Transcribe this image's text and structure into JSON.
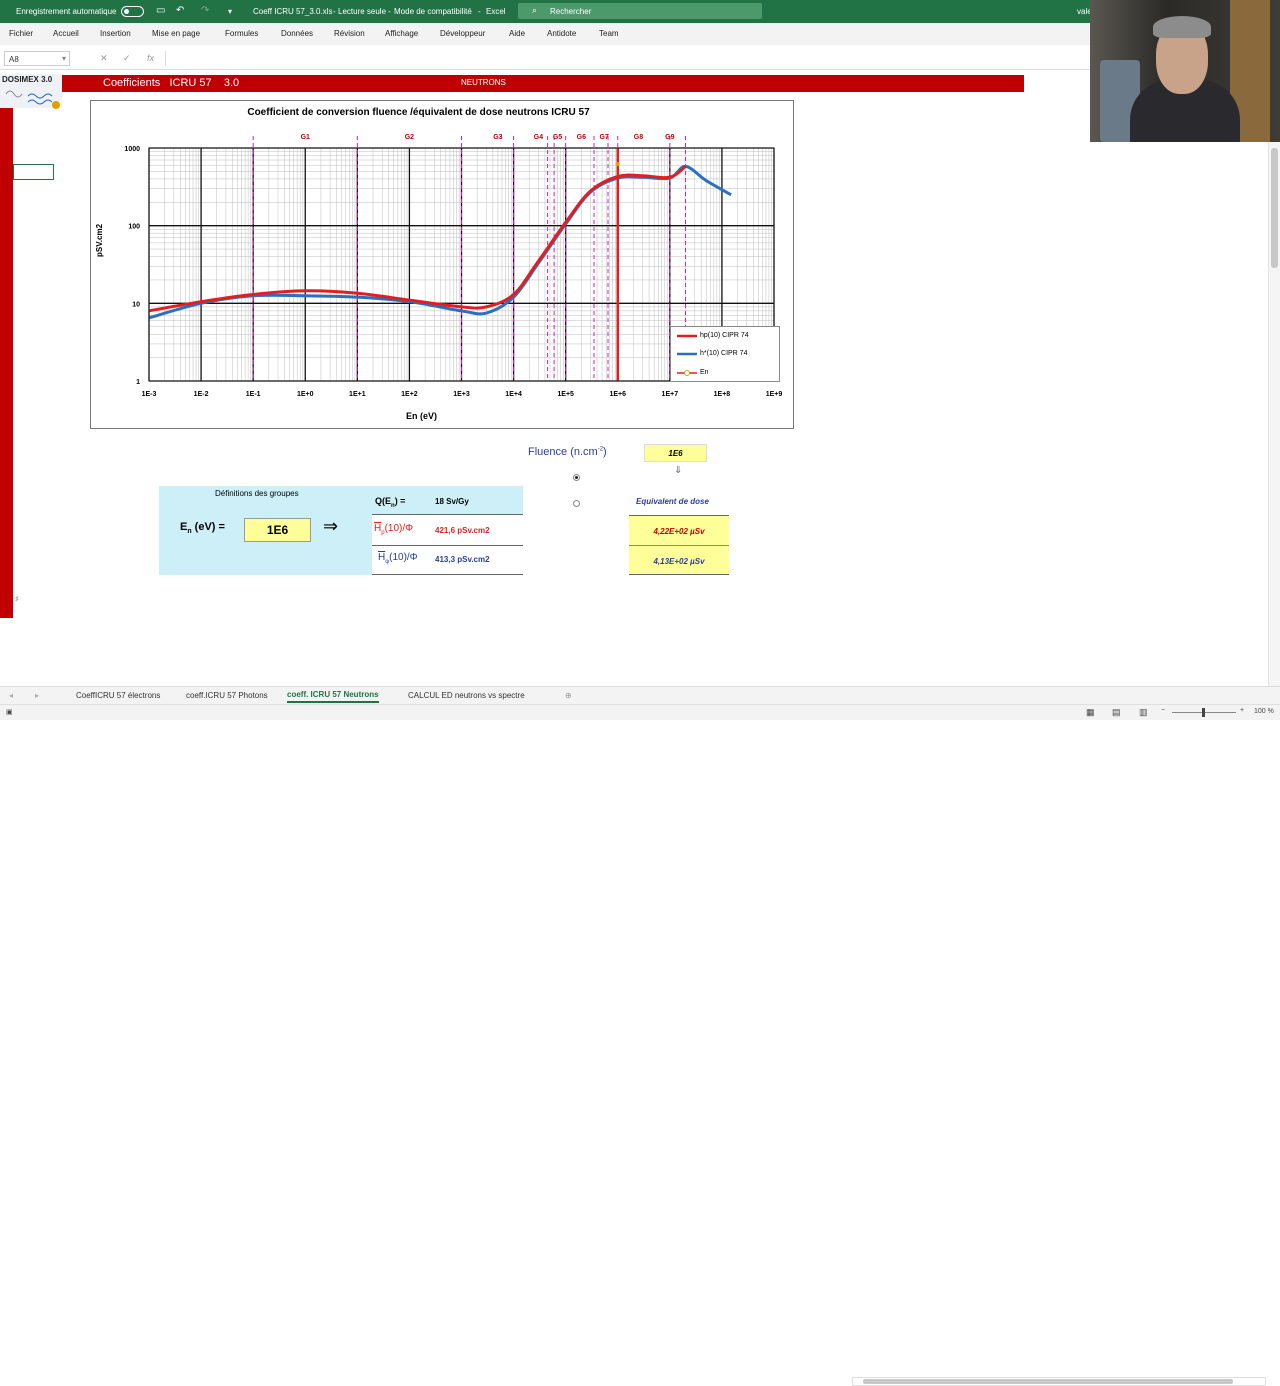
{
  "titlebar": {
    "autosave": "Enregistrement automatique",
    "filename": "Coeff ICRU 57_3.0.xls",
    "readonly": "Lecture seule",
    "compat": "Mode de compatibilité",
    "app": "Excel",
    "search_placeholder": "Rechercher",
    "user": "vale"
  },
  "menu": [
    "Fichier",
    "Accueil",
    "Insertion",
    "Mise en page",
    "Formules",
    "Données",
    "Révision",
    "Affichage",
    "Développeur",
    "Aide",
    "Antidote",
    "Team"
  ],
  "formula": {
    "cell_ref": "A8",
    "fx": "fx"
  },
  "banner": {
    "logo": "DOSIMEX 3.0",
    "title": "Coefficients   ICRU 57    3.0",
    "section": "NEUTRONS"
  },
  "chart_data": {
    "type": "line",
    "title": "Coefficient de conversion fluence /équivalent de dose neutrons ICRU 57",
    "xlabel": "En (eV)",
    "ylabel": "pSV.cm2",
    "xscale": "log",
    "yscale": "log",
    "xlim": [
      0.001,
      1000000000
    ],
    "ylim": [
      1,
      1000
    ],
    "xticks": [
      "1E-3",
      "1E-2",
      "1E-1",
      "1E+0",
      "1E+1",
      "1E+2",
      "1E+3",
      "1E+4",
      "1E+5",
      "1E+6",
      "1E+7",
      "1E+8",
      "1E+9"
    ],
    "yticks": [
      "1",
      "10",
      "100",
      "1000"
    ],
    "groups": [
      {
        "label": "G1",
        "x": 1
      },
      {
        "label": "G2",
        "x": 100
      },
      {
        "label": "G3",
        "x": 5000
      },
      {
        "label": "G4",
        "x": 30000
      },
      {
        "label": "G5",
        "x": 70000
      },
      {
        "label": "G6",
        "x": 200000
      },
      {
        "label": "G7",
        "x": 550000
      },
      {
        "label": "G8",
        "x": 2500000
      },
      {
        "label": "G9",
        "x": 10000000
      }
    ],
    "group_lines": [
      0.1,
      10,
      1000,
      10000,
      45000,
      60000,
      100000,
      350000,
      650000,
      1000000,
      10000000,
      20000000
    ],
    "grid": true,
    "legend_position": "bottom-right",
    "series": [
      {
        "name": "hp(10) CIPR 74",
        "color": "#e02020",
        "x": [
          0.001,
          0.01,
          0.1,
          1,
          10,
          100,
          1000,
          3000,
          10000,
          30000,
          100000,
          300000,
          1000000,
          3000000,
          10000000,
          20000000
        ],
        "y": [
          8,
          10.5,
          13,
          14.5,
          13.5,
          11,
          9,
          9,
          13,
          35,
          110,
          280,
          430,
          440,
          420,
          580
        ]
      },
      {
        "name": "h*(10) CIPR 74",
        "color": "#2a6fc0",
        "x": [
          0.001,
          0.01,
          0.1,
          1,
          10,
          100,
          1000,
          3000,
          10000,
          30000,
          100000,
          300000,
          1000000,
          3000000,
          10000000,
          20000000,
          50000000,
          150000000
        ],
        "y": [
          6.5,
          10,
          12.5,
          12.5,
          12,
          10.5,
          8,
          7.5,
          12,
          33,
          105,
          270,
          410,
          420,
          410,
          580,
          380,
          250
        ]
      }
    ],
    "marker_series": {
      "name": "En",
      "x": [
        1000000
      ],
      "color": "#e0a000"
    }
  },
  "calc": {
    "fluence_label": "Fluence (n.cm",
    "fluence_sup": "-2",
    "fluence_close": ")",
    "fluence_value": "1E6",
    "down_arrow": "⇓",
    "groups_title": "Définitions des groupes",
    "en_label": "E",
    "en_sub": "n",
    "en_unit": " (eV) =",
    "en_value": "1E6",
    "arrow": "⇒",
    "q_label": "Q(E",
    "q_sub": "n",
    "q_eq": ") =",
    "q_value": "18  Sv/Gy",
    "hp_label": "H",
    "hp_sub": "p",
    "hp_rest": "(10)/Φ",
    "hp_value": "421,6 pSv.cm2",
    "hs_label": "H",
    "hs_sub": "φ",
    "hs_rest": "(10)/Φ",
    "hs_value": "413,3 pSv.cm2",
    "equiv_title": "Equivalent de dose",
    "equiv_1": "4,22E+02 µSv",
    "equiv_2": "4,13E+02 µSv"
  },
  "tabs": [
    "CoeffICRU 57 électrons",
    "coeff.ICRU 57 Photons",
    "coeff. ICRU 57 Neutrons",
    "CALCUL ED neutrons vs spectre"
  ],
  "active_tab": 2,
  "status": {
    "zoom": "100 %"
  }
}
